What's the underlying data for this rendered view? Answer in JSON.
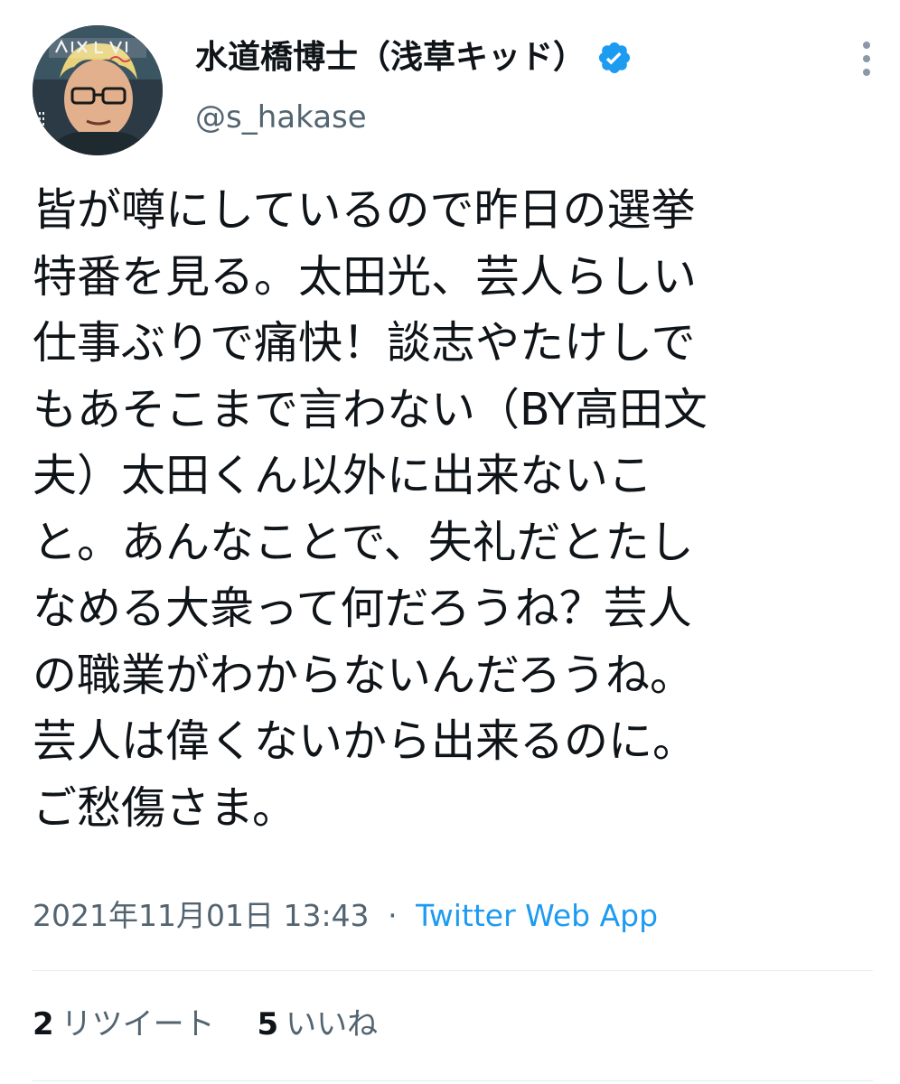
{
  "tweet": {
    "author": {
      "display_name": "水道橋博士（浅草キッド）",
      "handle": "@s_hakase",
      "verified": true,
      "avatar_icon": "avatar-illustration"
    },
    "text_lines": [
      "皆が噂にしているので昨日の選挙",
      "特番を見る。太田光、芸人らしい",
      "仕事ぶりで痛快！談志やたけしで",
      "もあそこまで言わない（BY高田文",
      "夫）太田くん以外に出来ないこ",
      "と。あんなことで、失礼だとたし",
      "なめる大衆って何だろうね？芸人",
      "の職業がわからないんだろうね。",
      "芸人は偉くないから出来るのに。",
      "ご愁傷さま。"
    ],
    "timestamp": "2021年11月01日 13:43",
    "separator": "·",
    "source": "Twitter Web App",
    "retweets": {
      "count": "2",
      "label": "リツイート"
    },
    "likes": {
      "count": "5",
      "label": "いいね"
    }
  },
  "colors": {
    "text": "#0f1419",
    "secondary_text": "#536471",
    "link": "#1d9bf0",
    "verified_badge": "#1d9bf0",
    "divider": "#e6ecf0"
  }
}
